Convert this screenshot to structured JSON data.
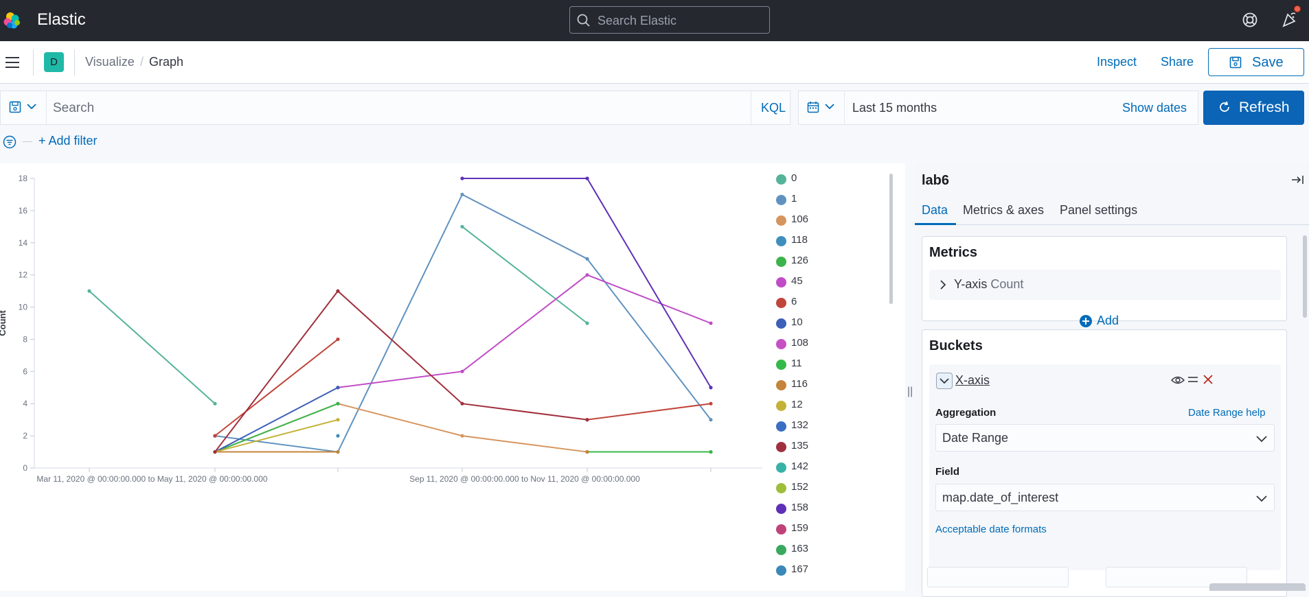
{
  "header": {
    "brand": "Elastic",
    "search_placeholder": "Search Elastic"
  },
  "appbar": {
    "space_initial": "D",
    "breadcrumbs": [
      "Visualize",
      "Graph"
    ],
    "breadcrumb_separator": "/",
    "inspect_label": "Inspect",
    "share_label": "Share",
    "save_label": "Save"
  },
  "query": {
    "placeholder": "Search",
    "language": "KQL"
  },
  "time": {
    "range": "Last 15 months",
    "show_dates": "Show dates",
    "refresh_label": "Refresh"
  },
  "filters": {
    "add_filter": "+ Add filter"
  },
  "colors": {
    "accent": "#006bb8",
    "refresh_bg": "#0b64b5",
    "header_bg": "#25282f",
    "space_badge": "#20b9a8"
  },
  "chart_data": {
    "type": "line",
    "ylabel": "Count",
    "ylim": [
      0,
      18
    ],
    "y_ticks": [
      0,
      2,
      4,
      6,
      8,
      10,
      12,
      14,
      16,
      18
    ],
    "x": [
      1,
      2,
      3,
      4,
      5,
      6
    ],
    "x_tick_labels": [
      {
        "between": [
          1,
          2
        ],
        "label": "Mar 11, 2020 @ 00:00:00.000 to May 11, 2020 @ 00:00:00.000"
      },
      {
        "between": [
          4,
          5
        ],
        "label": "Sep 11, 2020 @ 00:00:00.000 to Nov 11, 2020 @ 00:00:00.000"
      }
    ],
    "series": [
      {
        "name": "0",
        "color": "#54b399",
        "values": [
          11,
          4,
          null,
          15,
          9,
          null
        ]
      },
      {
        "name": "1",
        "color": "#6092c0",
        "values": [
          null,
          2,
          1,
          17,
          13,
          3
        ]
      },
      {
        "name": "106",
        "color": "#d6955e",
        "values": [
          null,
          1,
          4,
          2,
          1,
          1
        ]
      },
      {
        "name": "118",
        "color": "#3f8fbd",
        "values": [
          null,
          null,
          2,
          null,
          1,
          null
        ]
      },
      {
        "name": "126",
        "color": "#3cb44b",
        "values": [
          null,
          1,
          4,
          null,
          null,
          null
        ]
      },
      {
        "name": "45",
        "color": "#c04cc7",
        "values": [
          null,
          null,
          5,
          6,
          12,
          9
        ]
      },
      {
        "name": "6",
        "color": "#c0453a",
        "values": [
          null,
          2,
          8,
          null,
          3,
          4
        ]
      },
      {
        "name": "10",
        "color": "#3d5fb8",
        "values": [
          null,
          1,
          5,
          null,
          null,
          null
        ]
      },
      {
        "name": "108",
        "color": "#c64fc4",
        "values": [
          null,
          null,
          null,
          null,
          null,
          null
        ]
      },
      {
        "name": "11",
        "color": "#35b84a",
        "values": [
          null,
          1,
          1,
          null,
          1,
          1
        ]
      },
      {
        "name": "116",
        "color": "#c5843a",
        "values": [
          null,
          1,
          1,
          null,
          1,
          null
        ]
      },
      {
        "name": "12",
        "color": "#c3b236",
        "values": [
          null,
          1,
          3,
          null,
          null,
          null
        ]
      },
      {
        "name": "132",
        "color": "#3a6ec2",
        "values": [
          null,
          null,
          null,
          null,
          null,
          null
        ]
      },
      {
        "name": "135",
        "color": "#a0303d",
        "values": [
          null,
          1,
          11,
          4,
          3,
          null
        ]
      },
      {
        "name": "142",
        "color": "#36b3a6",
        "values": [
          null,
          null,
          null,
          null,
          null,
          null
        ]
      },
      {
        "name": "152",
        "color": "#9ebe3b",
        "values": [
          null,
          null,
          null,
          null,
          null,
          null
        ]
      },
      {
        "name": "158",
        "color": "#5e30b8",
        "values": [
          null,
          null,
          null,
          18,
          18,
          5
        ]
      },
      {
        "name": "159",
        "color": "#c0427a",
        "values": [
          null,
          null,
          null,
          null,
          null,
          null
        ]
      },
      {
        "name": "163",
        "color": "#3aa85e",
        "values": [
          null,
          null,
          null,
          null,
          null,
          null
        ]
      },
      {
        "name": "167",
        "color": "#3a88b8",
        "values": [
          null,
          null,
          null,
          null,
          null,
          null
        ]
      }
    ]
  },
  "sidebar": {
    "title": "lab6",
    "tabs": [
      {
        "label": "Data"
      },
      {
        "label": "Metrics & axes"
      },
      {
        "label": "Panel settings"
      }
    ],
    "metrics": {
      "title": "Metrics",
      "row_axis": "Y-axis",
      "row_agg": "Count",
      "add_label": "Add"
    },
    "buckets": {
      "title": "Buckets",
      "axis_label": "X-axis",
      "aggregation_label": "Aggregation",
      "aggregation_help": "Date Range help",
      "aggregation_value": "Date Range",
      "field_label": "Field",
      "field_value": "map.date_of_interest",
      "formats_link": "Acceptable date formats"
    }
  }
}
